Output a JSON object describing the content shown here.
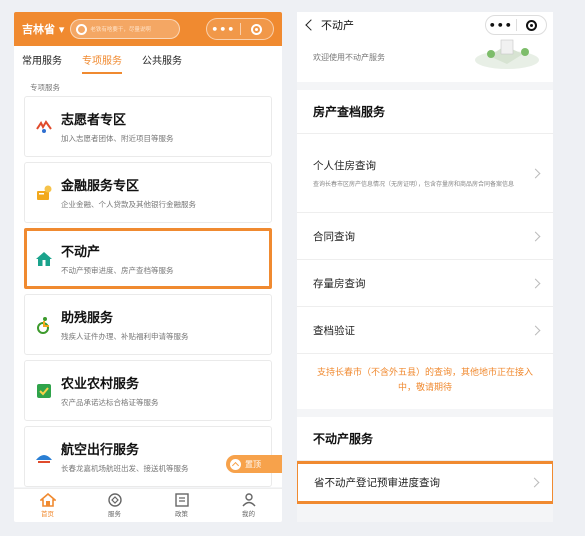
{
  "left": {
    "region": "吉林省 ▾",
    "search_placeholder": "老铁有啥要干，尽量说啊",
    "tabs": [
      "常用服务",
      "专项服务",
      "公共服务"
    ],
    "section_label": "专项服务",
    "cards": [
      {
        "title": "志愿者专区",
        "desc": "加入志愿者团体、附近项目等服务",
        "icon": "volunteer-icon",
        "color": "#e04b2c"
      },
      {
        "title": "金融服务专区",
        "desc": "企业金融、个人贷款及其他银行金融服务",
        "icon": "finance-icon",
        "color": "#f2a91d"
      },
      {
        "title": "不动产",
        "desc": "不动产预审进度、房产查档等服务",
        "icon": "real-estate-icon",
        "color": "#1aa38c"
      },
      {
        "title": "助残服务",
        "desc": "残疾人证件办理、补贴福利申请等服务",
        "icon": "disability-icon",
        "color": "#3c9a2c"
      },
      {
        "title": "农业农村服务",
        "desc": "农产品承诺达标合格证等服务",
        "icon": "agriculture-icon",
        "color": "#2fa34a"
      },
      {
        "title": "航空出行服务",
        "desc": "长春龙嘉机场航班出发、接送机等服务",
        "icon": "airplane-icon",
        "color": "#2a7fd4"
      }
    ],
    "top_button": "置顶",
    "bottom_nav": [
      "首页",
      "服务",
      "政策",
      "我的"
    ]
  },
  "right": {
    "title": "不动产",
    "welcome": "欢迎使用不动产服务",
    "group1_title": "房产查档服务",
    "rows": [
      {
        "label": "个人住房查询",
        "sub": "查询长春市区房产信息情况（无房证明），包含存量房和商品房合同备案信息"
      },
      {
        "label": "合同查询"
      },
      {
        "label": "存量房查询"
      },
      {
        "label": "查档验证"
      }
    ],
    "notice": "支持长春市（不含外五县）的查询，其他地市正在接入中，敬请期待",
    "group2_title": "不动产服务",
    "progress_row": "省不动产登记预审进度查询"
  },
  "colors": {
    "accent": "#f08a30",
    "highlight_border": "#f08a30"
  }
}
